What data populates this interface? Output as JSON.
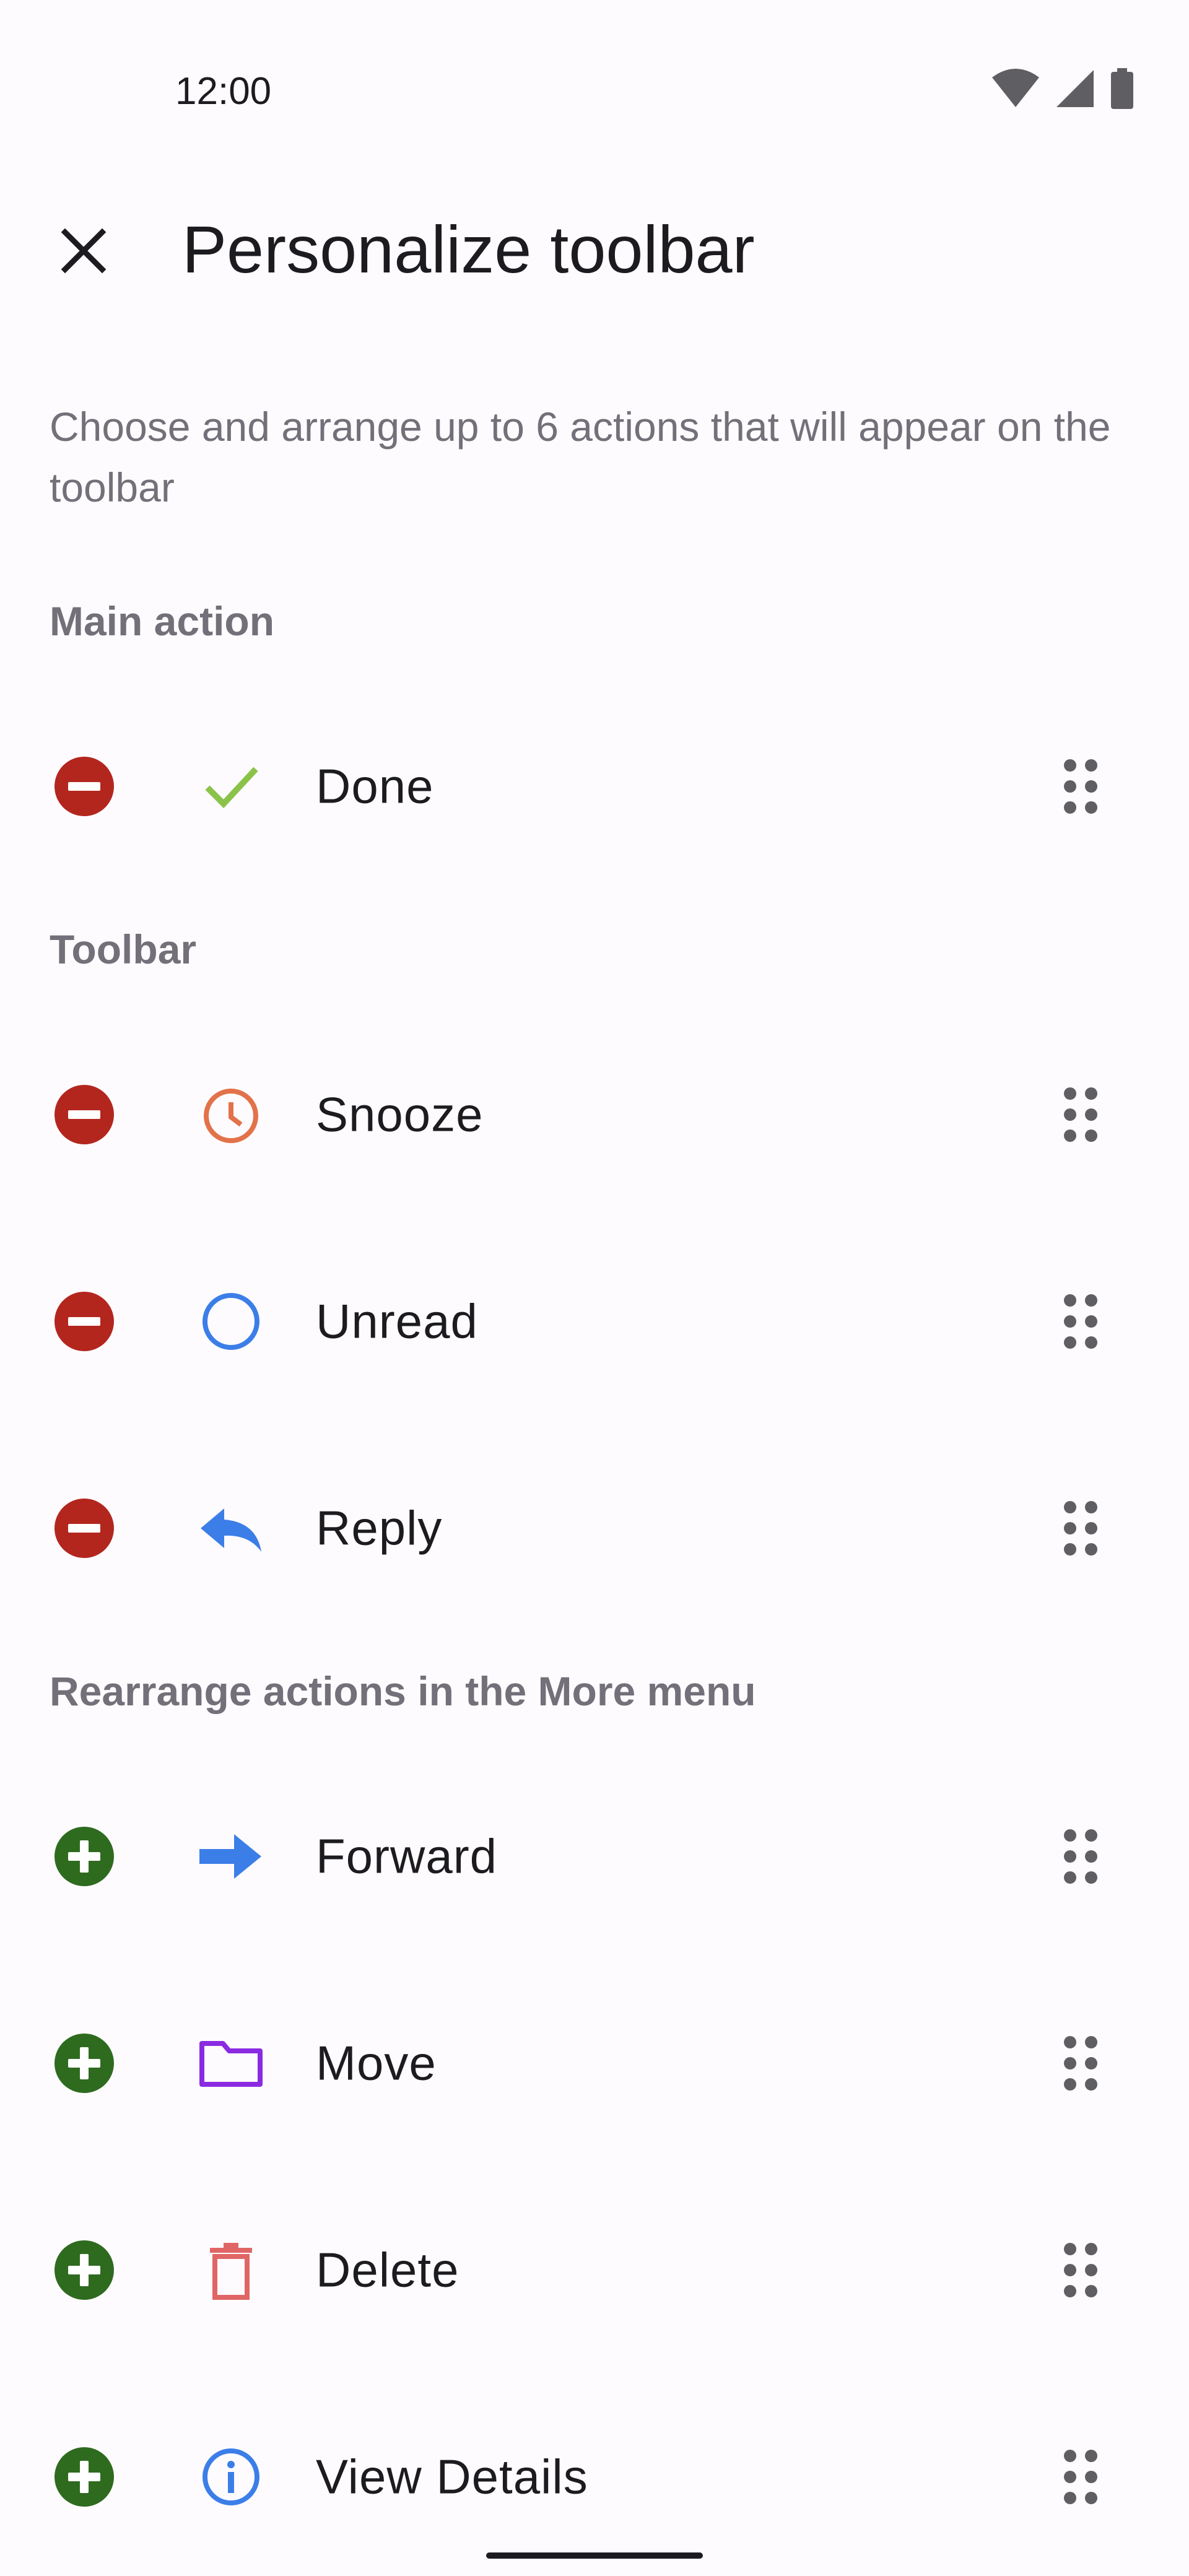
{
  "status_bar": {
    "time": "12:00",
    "icons": [
      "wifi-icon",
      "signal-icon",
      "battery-icon"
    ]
  },
  "app_bar": {
    "close_icon": "close-icon",
    "title": "Personalize toolbar"
  },
  "description": "Choose and arrange up to 6 actions that will appear on the toolbar",
  "sections": {
    "main": {
      "header": "Main action",
      "items": [
        {
          "label": "Done",
          "icon": "check-icon",
          "state": "remove"
        }
      ]
    },
    "toolbar": {
      "header": "Toolbar",
      "items": [
        {
          "label": "Snooze",
          "icon": "clock-icon",
          "state": "remove"
        },
        {
          "label": "Unread",
          "icon": "circle-icon",
          "state": "remove"
        },
        {
          "label": "Reply",
          "icon": "reply-icon",
          "state": "remove"
        }
      ]
    },
    "more": {
      "header": "Rearrange actions in the More menu",
      "items": [
        {
          "label": "Forward",
          "icon": "forward-arrow-icon",
          "state": "add"
        },
        {
          "label": "Move",
          "icon": "folder-icon",
          "state": "add"
        },
        {
          "label": "Delete",
          "icon": "trash-icon",
          "state": "add"
        },
        {
          "label": "View Details",
          "icon": "info-icon",
          "state": "add"
        }
      ]
    }
  },
  "colors": {
    "background": "#fefbfe",
    "remove": "#b3261e",
    "add": "#2e6b1f",
    "section_header": "#73707a",
    "check": "#8bc34a",
    "clock": "#e2724a",
    "blue": "#3c7ee8",
    "folder": "#8a2be2",
    "trash": "#e06666"
  }
}
